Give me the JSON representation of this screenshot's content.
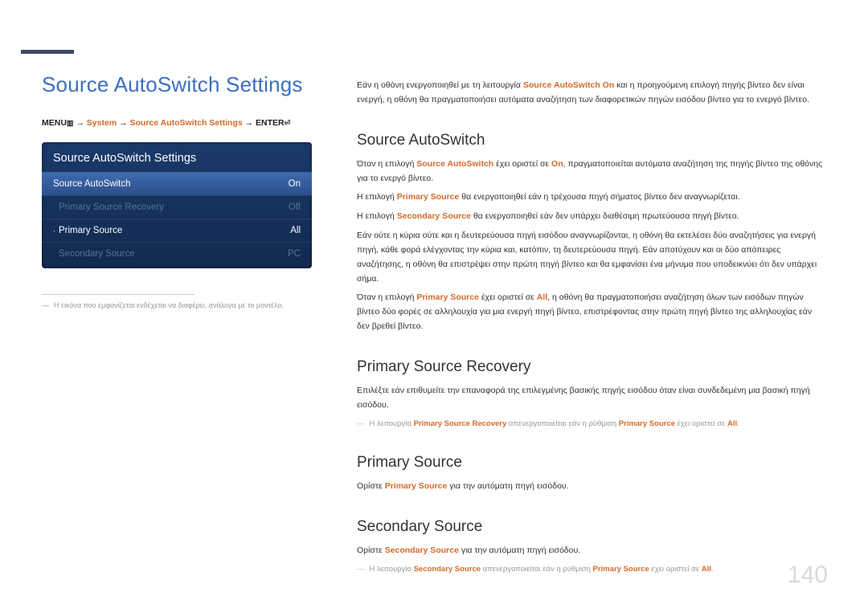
{
  "page": {
    "title": "Source AutoSwitch Settings",
    "number": "140"
  },
  "breadcrumb": {
    "menu": "MENU",
    "arrow": " → ",
    "system": "System",
    "settings": "Source AutoSwitch Settings",
    "enter": "ENTER"
  },
  "osd": {
    "title": "Source AutoSwitch Settings",
    "rows": [
      {
        "label": "Source AutoSwitch",
        "value": "On",
        "style": "highlight"
      },
      {
        "label": "Primary Source Recovery",
        "value": "Off",
        "style": "dim",
        "bullet": true
      },
      {
        "label": "Primary Source",
        "value": "All",
        "style": "normal",
        "bullet": true
      },
      {
        "label": "Secondary Source",
        "value": "PC",
        "style": "dim",
        "bullet": true
      }
    ]
  },
  "left_footnote": "Η εικόνα που εμφανίζεται ενδέχεται να διαφέρει, ανάλογα με το μοντέλο.",
  "intro_p1a": "Εάν η οθόνη ενεργοποιηθεί με τη λειτουργία ",
  "intro_hl": "Source AutoSwitch On",
  "intro_p1b": " και η προηγούμενη επιλογή πηγής βίντεο δεν είναι ενεργή, η οθόνη θα πραγματοποιήσει αυτόματα αναζήτηση των διαφορετικών πηγών εισόδου βίντεο για το ενεργό βίντεο.",
  "sec1": {
    "h": "Source AutoSwitch",
    "p1": {
      "a": "Όταν η επιλογή ",
      "hl1": "Source AutoSwitch",
      "b": " έχει οριστεί σε ",
      "hl2": "On",
      "c": ", πραγματοποιείται αυτόματα αναζήτηση της πηγής βίντεο της οθόνης για το ενεργό βίντεο."
    },
    "p2": {
      "a": "Η επιλογή ",
      "hl1": "Primary Source",
      "b": " θα ενεργοποιηθεί εάν η τρέχουσα πηγή σήματος βίντεο δεν αναγνωρίζεται."
    },
    "p3": {
      "a": "Η επιλογή ",
      "hl1": "Secondary Source",
      "b": " θα ενεργοποιηθεί εάν δεν υπάρχει διαθέσιμη πρωτεύουσα πηγή βίντεο."
    },
    "p4": "Εάν ούτε η κύρια ούτε και η δευτερεύουσα πηγή εισόδου αναγνωρίζονται, η οθόνη θα εκτελέσει δύο αναζητήσεις για ενεργή πηγή, κάθε φορά ελέγχοντας την κύρια και, κατόπιν, τη δευτερεύουσα πηγή. Εάν αποτύχουν και οι δύο απόπειρες αναζήτησης, η οθόνη θα επιστρέψει στην πρώτη πηγή βίντεο και θα εμφανίσει ένα μήνυμα που υποδεικνύει ότι δεν υπάρχει σήμα.",
    "p5": {
      "a": "Όταν η επιλογή ",
      "hl1": "Primary Source",
      "b": " έχει οριστεί σε ",
      "hl2": "All",
      "c": ", η οθόνη θα πραγματοποιήσει αναζήτηση όλων των εισόδων πηγών βίντεο δύο φορές σε αλληλουχία για μια ενεργή πηγή βίντεο, επιστρέφοντας στην πρώτη πηγή βίντεο της αλληλουχίας εάν δεν βρεθεί βίντεο."
    }
  },
  "sec2": {
    "h": "Primary Source Recovery",
    "p1": "Επιλέξτε εάν επιθυμείτε την επαναφορά της επιλεγμένης βασικής πηγής εισόδου όταν είναι συνδεδεμένη μια βασική πηγή εισόδου.",
    "note": {
      "a": "Η λειτουργία ",
      "hl1": "Primary Source Recovery",
      "b": " απενεργοποιείται εάν η ρύθμιση ",
      "hl2": "Primary Source",
      "c": " έχει οριστεί σε ",
      "hl3": "All",
      "d": "."
    }
  },
  "sec3": {
    "h": "Primary Source",
    "p1": {
      "a": "Ορίστε ",
      "hl1": "Primary Source",
      "b": " για την αυτόματη πηγή εισόδου."
    }
  },
  "sec4": {
    "h": "Secondary Source",
    "p1": {
      "a": "Ορίστε ",
      "hl1": "Secondary Source",
      "b": " για την αυτόματη πηγή εισόδου."
    },
    "note": {
      "a": "Η λειτουργία ",
      "hl1": "Secondary Source",
      "b": " απενεργοποιείται εάν η ρύθμιση ",
      "hl2": "Primary Source",
      "c": " έχει οριστεί σε ",
      "hl3": "All",
      "d": "."
    }
  }
}
